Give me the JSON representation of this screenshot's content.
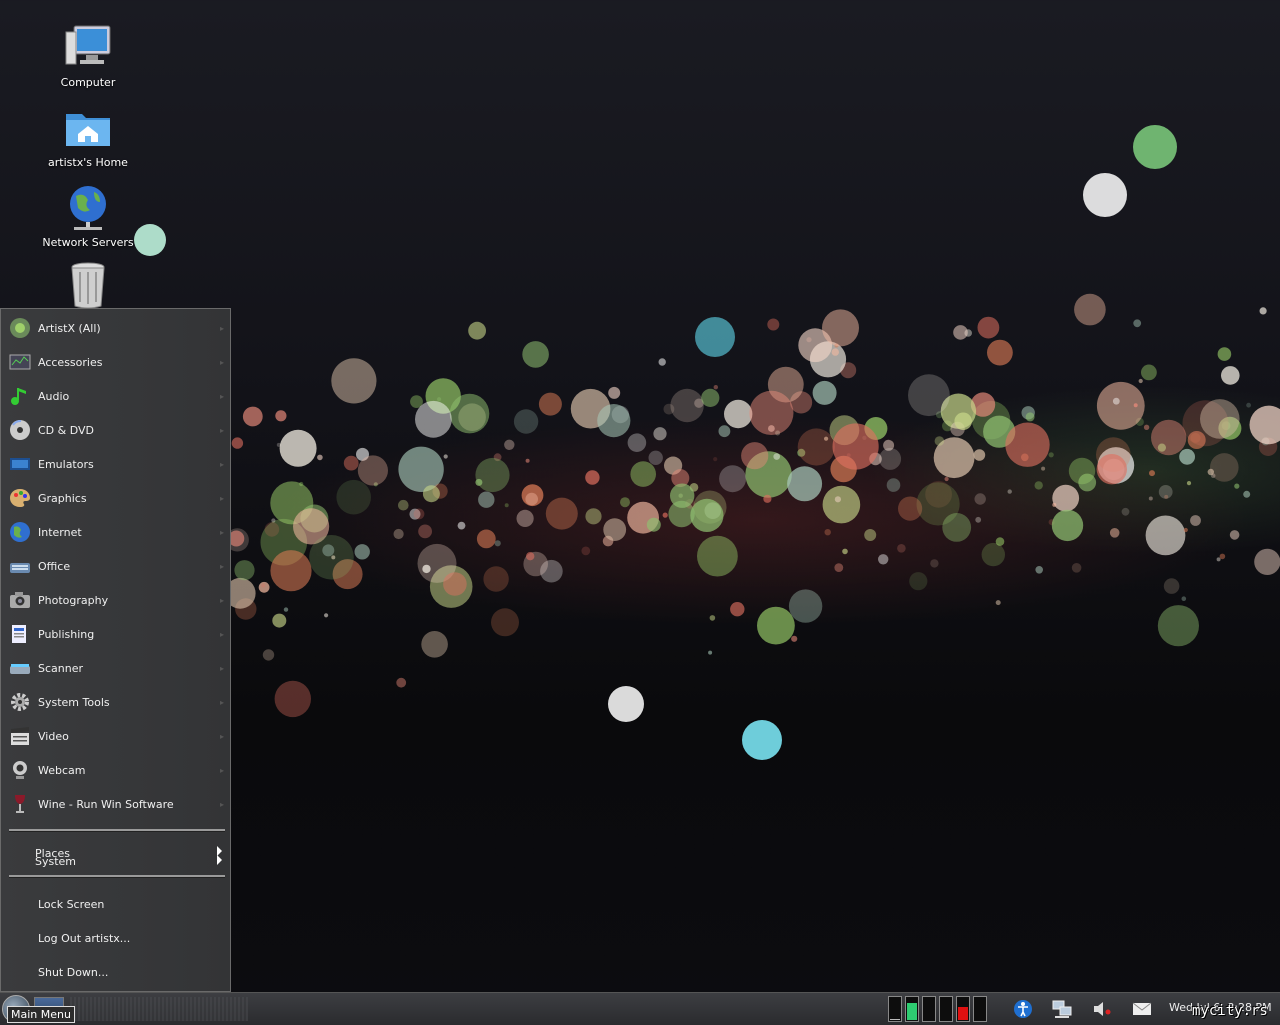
{
  "desktop": {
    "icons": [
      {
        "label": "Computer",
        "icon": "computer-icon"
      },
      {
        "label": "artistx's Home",
        "icon": "home-folder-icon"
      },
      {
        "label": "Network Servers",
        "icon": "network-globe-icon"
      },
      {
        "label": "",
        "icon": "trash-icon"
      }
    ]
  },
  "menu": {
    "categories": [
      {
        "label": "ArtistX (All)",
        "icon": "artistx-icon"
      },
      {
        "label": "Accessories",
        "icon": "accessories-icon"
      },
      {
        "label": "Audio",
        "icon": "audio-note-icon"
      },
      {
        "label": "CD & DVD",
        "icon": "cd-dvd-icon"
      },
      {
        "label": "Emulators",
        "icon": "emulators-icon"
      },
      {
        "label": "Graphics",
        "icon": "palette-icon"
      },
      {
        "label": "Internet",
        "icon": "globe-icon"
      },
      {
        "label": "Office",
        "icon": "office-icon"
      },
      {
        "label": "Photography",
        "icon": "camera-icon"
      },
      {
        "label": "Publishing",
        "icon": "publishing-icon"
      },
      {
        "label": "Scanner",
        "icon": "scanner-icon"
      },
      {
        "label": "System Tools",
        "icon": "gear-icon"
      },
      {
        "label": "Video",
        "icon": "clapperboard-icon"
      },
      {
        "label": "Webcam",
        "icon": "webcam-icon"
      },
      {
        "label": "Wine - Run Win Software",
        "icon": "wine-glass-icon"
      }
    ],
    "submenus": [
      {
        "label": "Places"
      },
      {
        "label": "System"
      }
    ],
    "actions": [
      {
        "label": "Lock Screen"
      },
      {
        "label": "Log Out artistx..."
      },
      {
        "label": "Shut Down..."
      }
    ]
  },
  "taskbar": {
    "tooltip": "Main Menu",
    "clock": "Wed Jul  6, 8:28 PM",
    "system_monitor_levels": [
      0.05,
      0.7,
      0.0,
      0.0,
      0.55,
      0.0
    ],
    "system_monitor_colors": [
      "#bbbbbb",
      "#2ecc71",
      "#bbbbbb",
      "#bbbbbb",
      "#e01010",
      "#bbbbbb"
    ],
    "tray_icons": [
      "accessibility-icon",
      "network-icon",
      "volume-muted-icon",
      "mail-icon"
    ]
  },
  "watermark": "mycity.rs"
}
